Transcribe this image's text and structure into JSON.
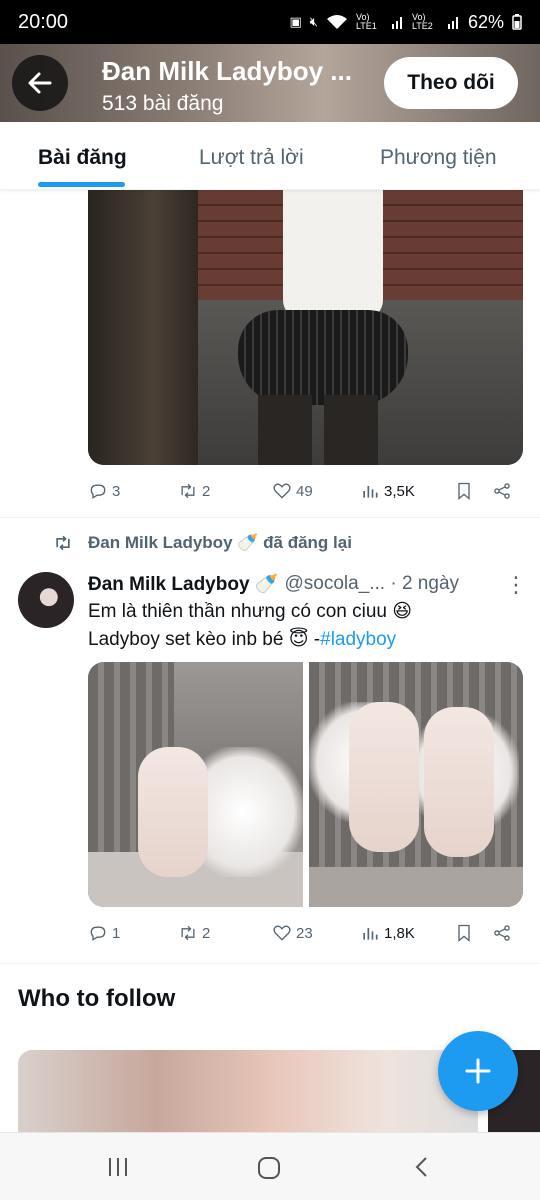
{
  "status_bar": {
    "time": "20:00",
    "sim1": "Vo) LTE1",
    "sim2": "Vo) LTE2",
    "battery": "62%"
  },
  "header": {
    "title": "Đan Milk Ladyboy ...",
    "post_count": "513 bài đăng",
    "follow_label": "Theo dõi"
  },
  "tabs": [
    {
      "label": "Bài đăng",
      "active": true
    },
    {
      "label": "Lượt trả lời",
      "active": false
    },
    {
      "label": "Phương tiện",
      "active": false
    }
  ],
  "post1": {
    "replies": "3",
    "reposts": "2",
    "likes": "49",
    "views": "3,5K"
  },
  "repost_notice": "Đan Milk Ladyboy 🍼 đã đăng lại",
  "post2": {
    "name": "Đan Milk Ladyboy 🍼",
    "handle": "@socola_... · 2 ngày",
    "text_line1": "Em là thiên thần nhưng có con ciuu 😆",
    "text_line2_prefix": "Ladyboy set kèo inb bé 😇 -",
    "hashtag": "#ladyboy",
    "replies": "1",
    "reposts": "2",
    "likes": "23",
    "views": "1,8K"
  },
  "who_to_follow": "Who to follow",
  "colors": {
    "accent": "#1d9bf0",
    "secondary_text": "#536471",
    "primary_text": "#0f1419"
  }
}
